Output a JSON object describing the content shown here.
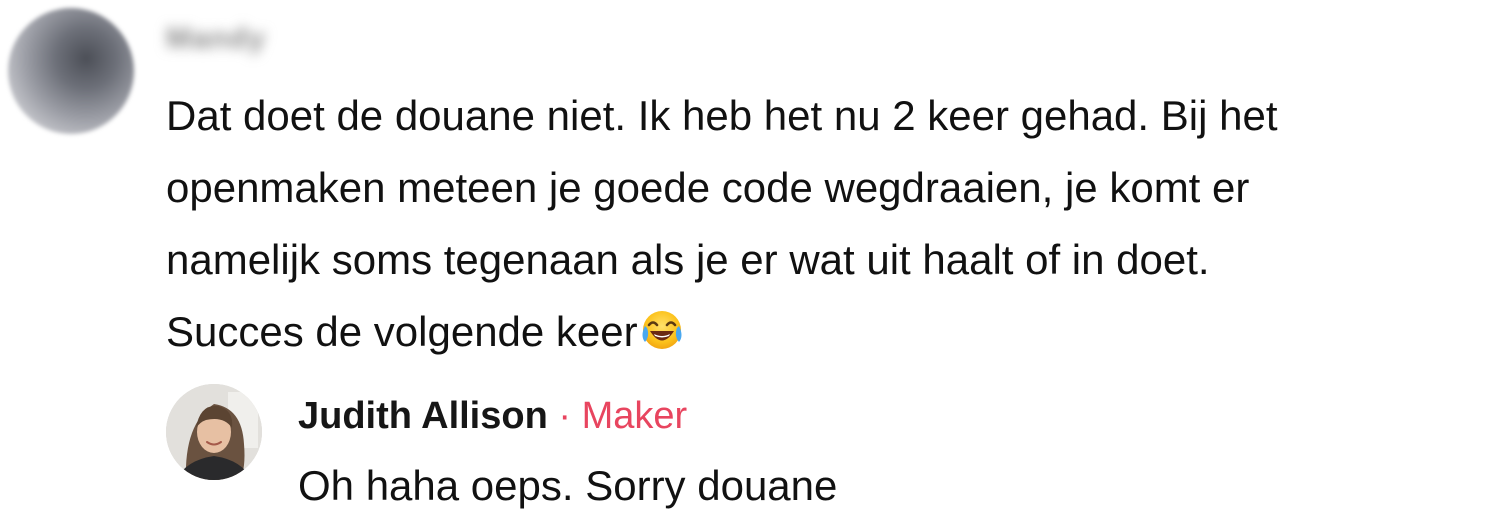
{
  "comment": {
    "author": "Mandy",
    "text": "Dat doet de douane niet. Ik heb het nu 2 keer gehad. Bij het\nopenmaken meteen je goede code wegdraaien, je komt er\nnamelijk soms tegenaan als je er wat uit haalt of in doet.\nSucces de volgende keer",
    "emoji": "face-with-tears-of-joy-icon"
  },
  "reply": {
    "author": "Judith Allison",
    "separator": "·",
    "badge": "Maker",
    "text": "Oh haha oeps. Sorry douane",
    "badge_color": "#e8455f"
  }
}
